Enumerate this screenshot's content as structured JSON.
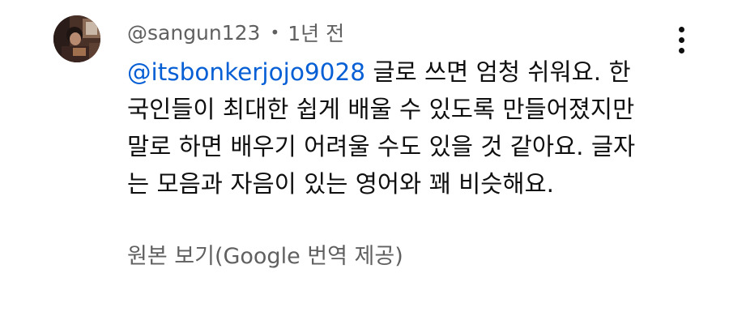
{
  "comment": {
    "author": "@sangun123",
    "separator": "•",
    "time": "1년 전",
    "mention": "@itsbonkerjojo9028",
    "lines": [
      " 글로 쓰면 엄청 쉬워요. 한",
      "국인들이 최대한 쉽게 배울 수 있도록 만들어졌지만",
      "말로 하면 배우기 어려울 수도 있을 것 같아요. 글자",
      "는 모음과 자음이 있는 영어와 꽤 비슷해요."
    ],
    "translate_link": "원본 보기(Google 번역 제공)",
    "menu_icon": "more-vertical-icon"
  },
  "colors": {
    "text": "#0f0f0f",
    "secondary": "#606060",
    "mention": "#065fd4",
    "background": "#ffffff"
  }
}
